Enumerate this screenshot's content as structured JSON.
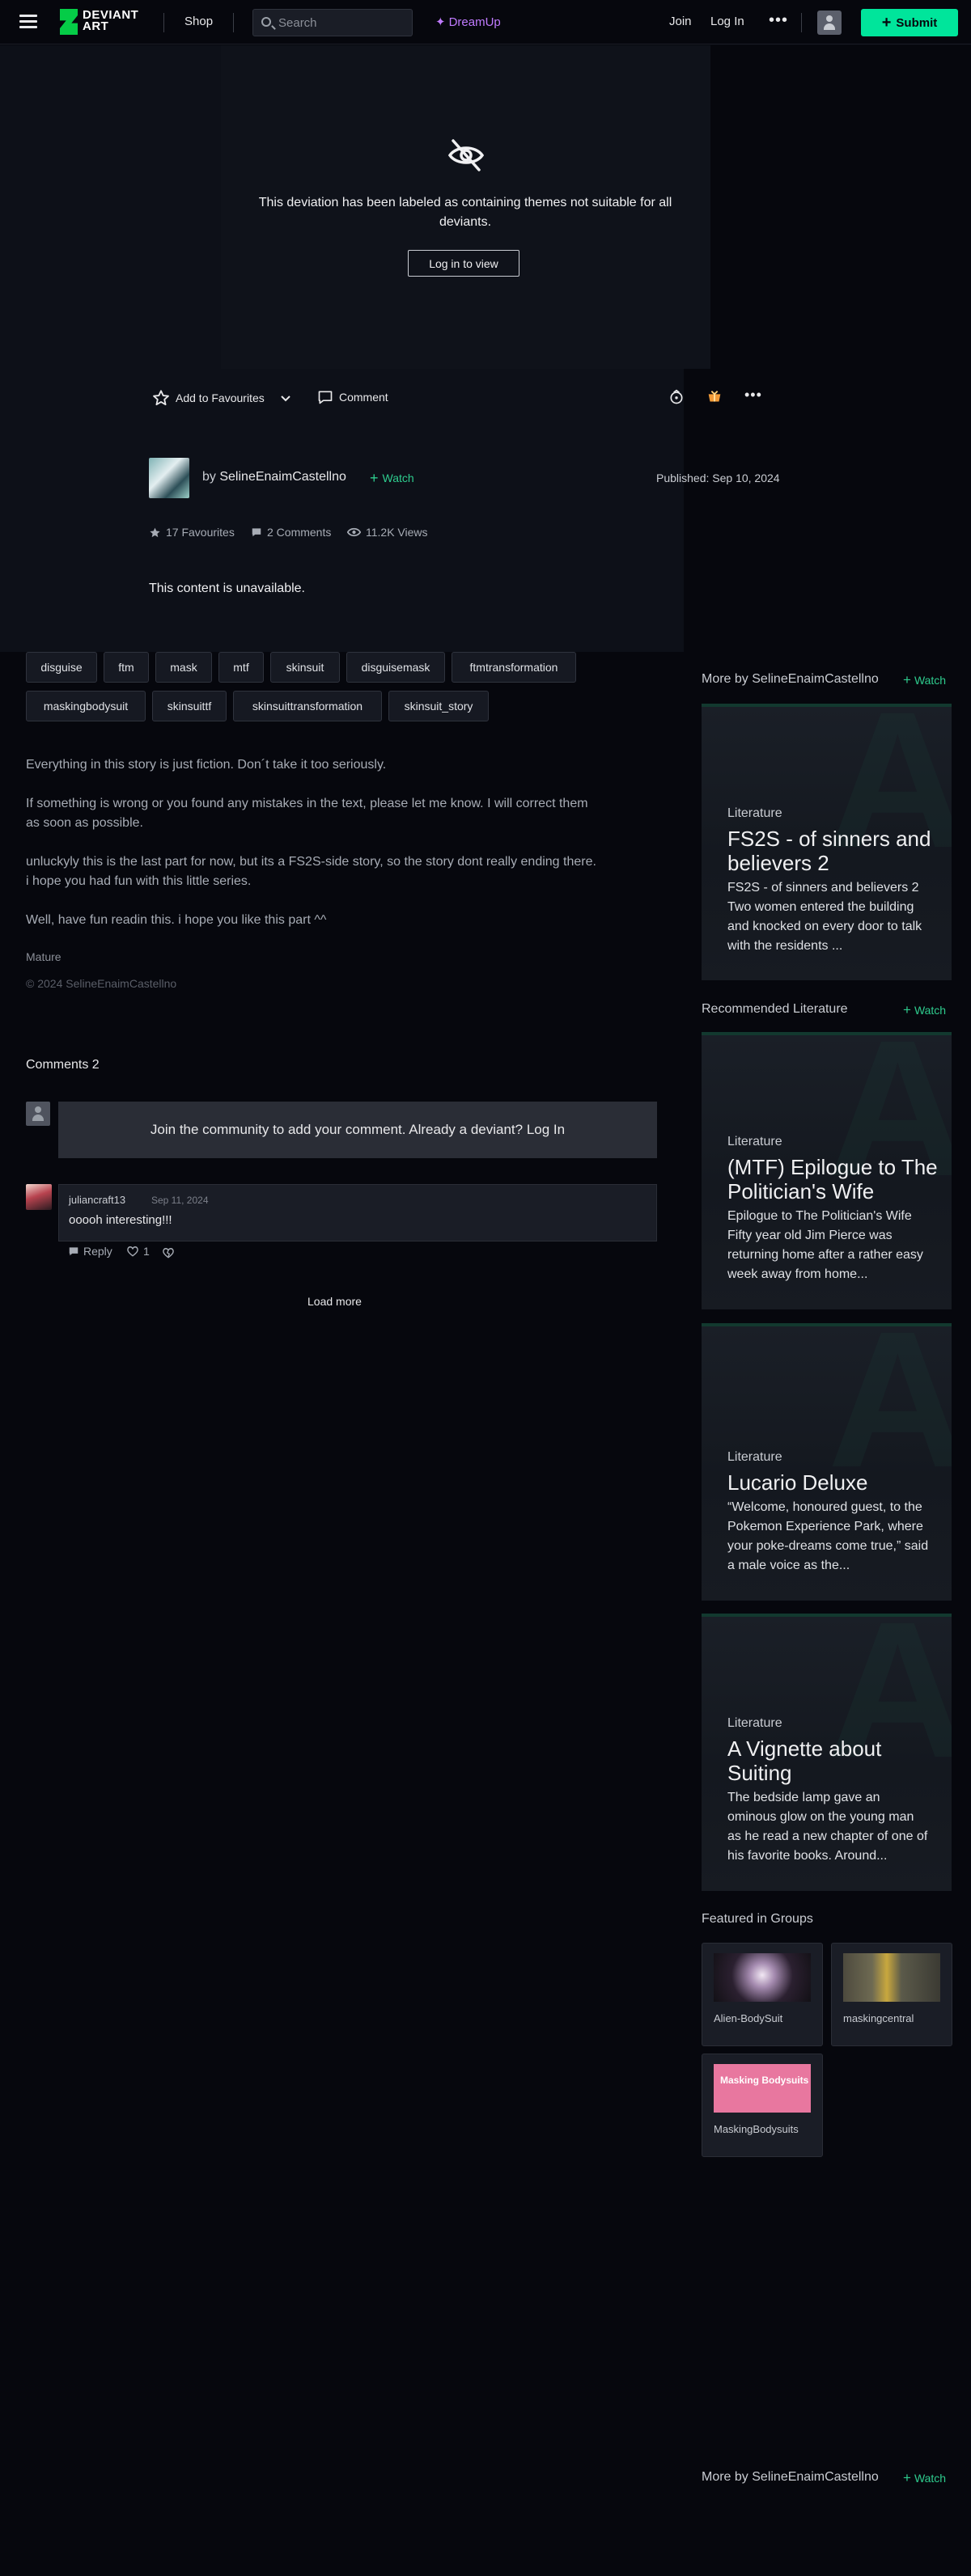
{
  "header": {
    "logo_text": "DEVIANT ART",
    "shop": "Shop",
    "search_placeholder": "Search",
    "dreamup": "DreamUp",
    "join": "Join",
    "login": "Log In",
    "more": "•••",
    "submit": "Submit"
  },
  "deviation": {
    "mature_message": "This deviation has been labeled as containing themes not suitable for all deviants.",
    "login_to_view": "Log in to view",
    "add_favourites": "Add to Favourites",
    "comment": "Comment",
    "more": "•••",
    "author_by": "by",
    "author_name": "SelineEnaimCastellno",
    "watch": "Watch",
    "published": "Published: Sep 10, 2024",
    "favourites": "17 Favourites",
    "comments_count": "2 Comments",
    "views": "11.2K Views",
    "unavailable": "This content is unavailable."
  },
  "tags": [
    "disguise",
    "ftm",
    "mask",
    "mtf",
    "skinsuit",
    "disguisemask",
    "ftmtransformation",
    "maskingbodysuit",
    "skinsuittf",
    "skinsuittransformation",
    "skinsuit_story"
  ],
  "description": {
    "paragraphs": [
      [
        "Everything in this story is just fiction. Don´t take it too seriously."
      ],
      [
        "If something is wrong or you found any mistakes in the text, please let me know. I will correct them",
        "as soon as possible."
      ],
      [
        "unluckyly this is the last part for now, but its a FS2S-side story, so the story dont really ending there.",
        "i hope you had fun with this little series."
      ],
      [
        "Well, have fun readin this. i hope you like this part ^^"
      ]
    ],
    "mature_label": "Mature",
    "copyright": "© 2024 SelineEnaimCastellno"
  },
  "comments": {
    "title": "Comments 2",
    "join_prompt": "Join the community to add your comment. Already a deviant? Log In",
    "items": [
      {
        "username": "juliancraft13",
        "date": "Sep 11, 2024",
        "text": "ooooh interesting!!!",
        "reply": "Reply",
        "likes": "1"
      }
    ],
    "load_more": "Load more"
  },
  "sidebar": {
    "more_by_title": "More by SelineEnaimCastellno",
    "recommended_title": "Recommended Literature",
    "watch": "Watch",
    "more_by_cards": [
      {
        "category": "Literature",
        "title": "FS2S - of sinners and believers 2",
        "excerpt": "FS2S - of sinners and believers 2 Two women entered the building and knocked on every door to talk with the residents ..."
      }
    ],
    "recommended_cards": [
      {
        "category": "Literature",
        "title": "(MTF) Epilogue to The Politician's Wife",
        "excerpt": "Epilogue to The Politician's Wife Fifty year old Jim Pierce was returning home after a rather easy week away from home..."
      },
      {
        "category": "Literature",
        "title": "Lucario Deluxe",
        "excerpt": "“Welcome, honoured guest, to the Pokemon Experience Park, where your poke-dreams come true,” said a male voice as the..."
      },
      {
        "category": "Literature",
        "title": "A Vignette about Suiting",
        "excerpt": "The bedside lamp gave an ominous glow on the young man as he read a new chapter of one of his favorite books. Around..."
      }
    ],
    "groups_title": "Featured in Groups",
    "groups": [
      {
        "name": "Alien-BodySuit"
      },
      {
        "name": "maskingcentral"
      },
      {
        "name": "MaskingBodysuits",
        "thumb_text": "Masking Bodysuits"
      }
    ],
    "bottom_more_by_title": "More by SelineEnaimCastellno"
  },
  "colors": {
    "accent_green": "#00e59b",
    "watch_green": "#2ecc8e",
    "dreamup_purple": "#c07bff",
    "background": "#06070d"
  }
}
